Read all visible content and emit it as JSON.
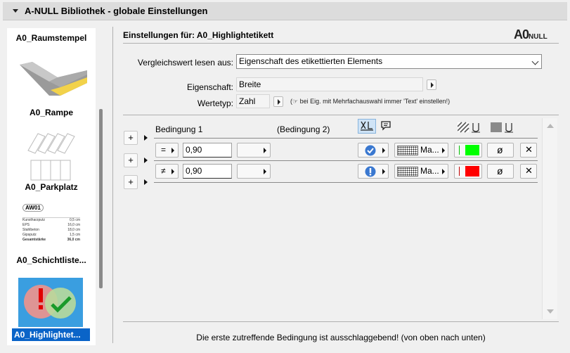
{
  "window": {
    "title": "A-NULL Bibliothek - globale Einstellungen"
  },
  "library": {
    "items": [
      {
        "label": "A0_Raumstempel"
      },
      {
        "label": "A0_Rampe"
      },
      {
        "label": "A0_Parkplatz"
      },
      {
        "label": "A0_Schichtliste..."
      },
      {
        "label": "A0_Highlightet..."
      }
    ],
    "schicht_preview": {
      "tag": "AW01",
      "rows": [
        {
          "name": "Kunstharzputz",
          "value": "0,5 cm"
        },
        {
          "name": "EPS",
          "value": "16,0 cm"
        },
        {
          "name": "Stahlbeton",
          "value": "18,0 cm"
        },
        {
          "name": "Gipsputz",
          "value": "1,5 cm"
        },
        {
          "name": "Gesamtstärke",
          "value": "36,0 cm"
        }
      ]
    }
  },
  "settings": {
    "header": "Einstellungen für: A0_Highlightetikett",
    "logo_text": "A0",
    "logo_sub": "NULL",
    "compare_label": "Vergleichswert lesen aus:",
    "compare_value": "Eigenschaft des etikettierten Elements",
    "property_label": "Eigenschaft:",
    "property_value": "Breite",
    "valuetype_label": "Wertetyp:",
    "valuetype_value": "Zahl",
    "valuetype_hint": "(☞ bei Eig. mit Mehrfachauswahl immer 'Text' einstellen!)"
  },
  "conditions": {
    "col_condition1": "Bedingung 1",
    "col_condition2": "(Bedingung 2)",
    "rows": [
      {
        "operator": "=",
        "value": "0,90",
        "status_icon": "check-circle-icon",
        "pattern_label": "Ma...",
        "color": "#00ff00",
        "remove_symbol": "ø"
      },
      {
        "operator": "≠",
        "value": "0,90",
        "status_icon": "exclamation-circle-icon",
        "pattern_label": "Ma...",
        "color": "#ff0000",
        "remove_symbol": "ø"
      }
    ],
    "plus_label": "+",
    "delete_label": "✕",
    "footer": "Die erste zutreffende Bedingung ist ausschlaggebend! (von oben nach unten)"
  }
}
